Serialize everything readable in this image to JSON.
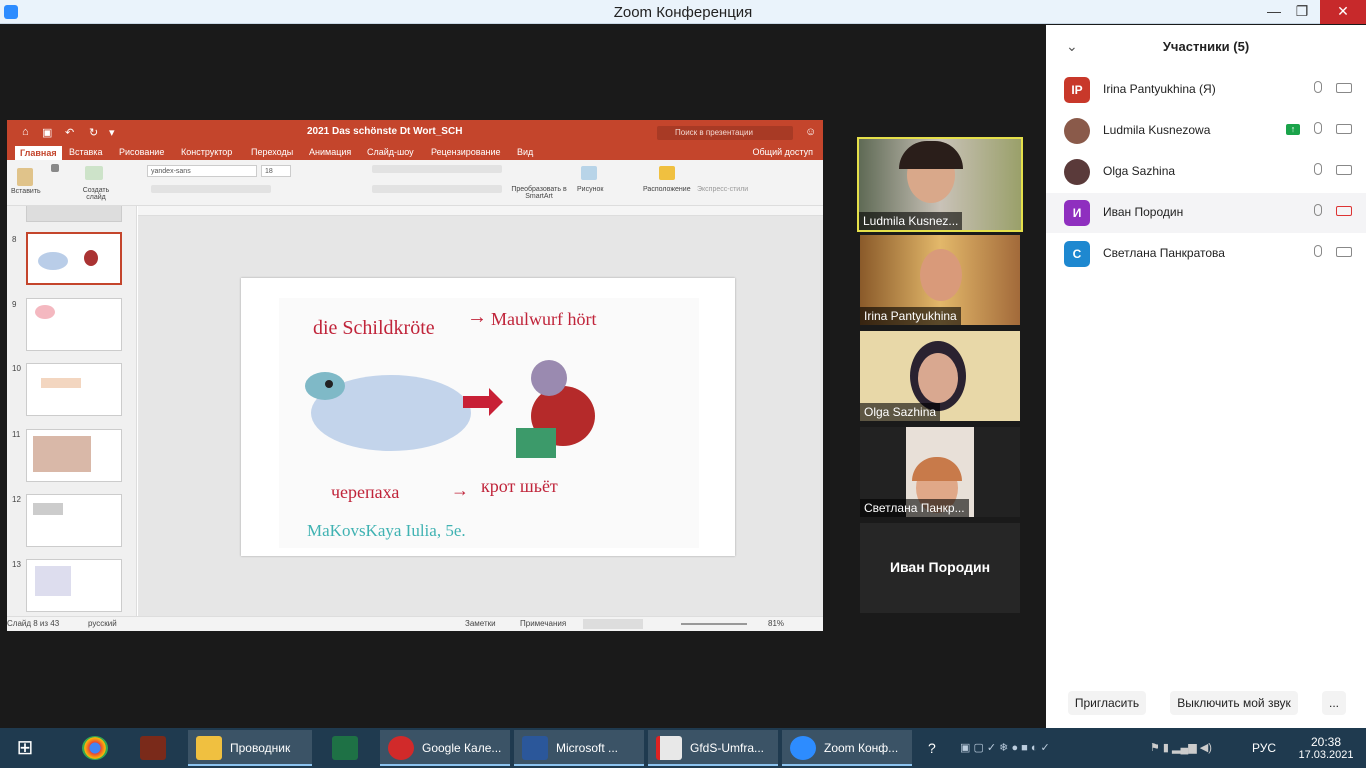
{
  "window": {
    "title": "Zoom Конференция",
    "minimize": "—",
    "maximize": "❐",
    "close": "✕"
  },
  "ppt": {
    "doc_title": "2021 Das schönste Dt Wort_SCH",
    "search_placeholder": "Поиск в презентации",
    "tabs": [
      "Главная",
      "Вставка",
      "Рисование",
      "Конструктор",
      "Переходы",
      "Анимация",
      "Слайд-шоу",
      "Рецензирование",
      "Вид"
    ],
    "share": "Общий доступ",
    "ribbon": {
      "paste": "Вставить",
      "create_slide": "Создать слайд",
      "font": "yandex-sans",
      "size": "18",
      "smartart": "Преобразовать в SmartArt",
      "picture": "Рисунок",
      "arrange": "Расположение",
      "express": "Экспресс-стили"
    },
    "thumbnails": [
      "8",
      "9",
      "10",
      "11",
      "12",
      "13"
    ],
    "status": {
      "slide": "Слайд 8 из 43",
      "lang": "русский",
      "notes": "Заметки",
      "comments": "Примечания",
      "zoom": "81%"
    },
    "slide": {
      "line1_left": "die Schildkröte",
      "line1_right": "Maulwurf hört",
      "line2_left": "черепаха",
      "line2_right": "крот шьёт",
      "signature": "MaKovsKaya Iulia, 5e."
    }
  },
  "videos": [
    {
      "name": "Ludmila Kusnez..."
    },
    {
      "name": "Irina Pantyukhina"
    },
    {
      "name": "Olga Sazhina"
    },
    {
      "name": "Светлана Панкр..."
    },
    {
      "name": "Иван Породин"
    }
  ],
  "panel": {
    "header": "Участники (5)",
    "participants": [
      {
        "initials": "IP",
        "name": "Irina Pantyukhina (Я)",
        "color": "#c8382a"
      },
      {
        "initials": "",
        "name": "Ludmila Kusnezowa",
        "color": "#8a5a4a"
      },
      {
        "initials": "",
        "name": "Olga Sazhina",
        "color": "#5a3a3a"
      },
      {
        "initials": "И",
        "name": "Иван Породин",
        "color": "#8f2fbf"
      },
      {
        "initials": "С",
        "name": "Светлана Панкратова",
        "color": "#1e88d0"
      }
    ],
    "invite": "Пригласить",
    "mute": "Выключить мой звук",
    "more": "..."
  },
  "taskbar": {
    "explorer": "Проводник",
    "google_cal": "Google Кале...",
    "word": "Microsoft ...",
    "pdf": "GfdS-Umfra...",
    "zoom": "Zoom Конф...",
    "lang": "РУС",
    "time": "20:38",
    "date": "17.03.2021"
  }
}
